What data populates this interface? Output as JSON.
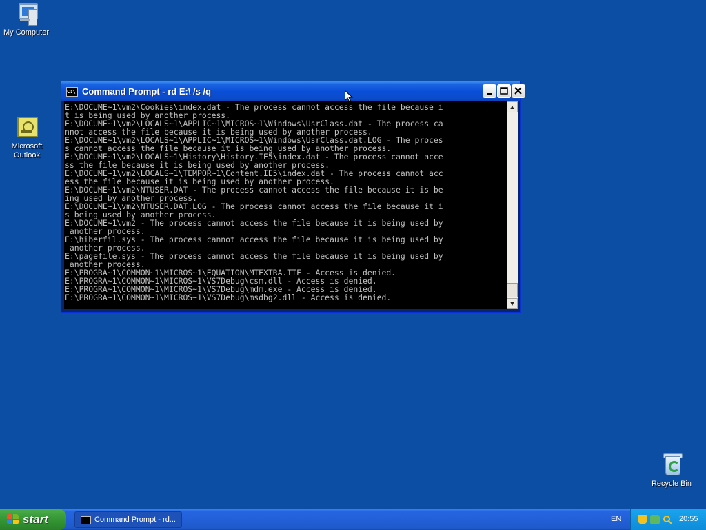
{
  "desktop": {
    "icons": {
      "my_computer": "My Computer",
      "outlook_line1": "Microsoft",
      "outlook_line2": "Outlook",
      "recycle_bin": "Recycle Bin"
    }
  },
  "window": {
    "title": "Command Prompt - rd E:\\ /s /q",
    "icon_text": "C:\\",
    "console_lines": [
      "E:\\DOCUME~1\\vm2\\Cookies\\index.dat - The process cannot access the file because i",
      "t is being used by another process.",
      "E:\\DOCUME~1\\vm2\\LOCALS~1\\APPLIC~1\\MICROS~1\\Windows\\UsrClass.dat - The process ca",
      "nnot access the file because it is being used by another process.",
      "E:\\DOCUME~1\\vm2\\LOCALS~1\\APPLIC~1\\MICROS~1\\Windows\\UsrClass.dat.LOG - The proces",
      "s cannot access the file because it is being used by another process.",
      "E:\\DOCUME~1\\vm2\\LOCALS~1\\History\\History.IE5\\index.dat - The process cannot acce",
      "ss the file because it is being used by another process.",
      "E:\\DOCUME~1\\vm2\\LOCALS~1\\TEMPOR~1\\Content.IE5\\index.dat - The process cannot acc",
      "ess the file because it is being used by another process.",
      "E:\\DOCUME~1\\vm2\\NTUSER.DAT - The process cannot access the file because it is be",
      "ing used by another process.",
      "E:\\DOCUME~1\\vm2\\NTUSER.DAT.LOG - The process cannot access the file because it i",
      "s being used by another process.",
      "E:\\DOCUME~1\\vm2 - The process cannot access the file because it is being used by",
      " another process.",
      "E:\\hiberfil.sys - The process cannot access the file because it is being used by",
      " another process.",
      "E:\\pagefile.sys - The process cannot access the file because it is being used by",
      " another process.",
      "E:\\PROGRA~1\\COMMON~1\\MICROS~1\\EQUATION\\MTEXTRA.TTF - Access is denied.",
      "E:\\PROGRA~1\\COMMON~1\\MICROS~1\\VS7Debug\\csm.dll - Access is denied.",
      "E:\\PROGRA~1\\COMMON~1\\MICROS~1\\VS7Debug\\mdm.exe - Access is denied.",
      "E:\\PROGRA~1\\COMMON~1\\MICROS~1\\VS7Debug\\msdbg2.dll - Access is denied."
    ]
  },
  "taskbar": {
    "start_label": "start",
    "task_label": "Command Prompt - rd...",
    "language": "EN",
    "clock": "20:55"
  },
  "colors": {
    "desktop": "#0d4ea5",
    "console_text": "#c0c0c0",
    "console_bg": "#000000"
  }
}
